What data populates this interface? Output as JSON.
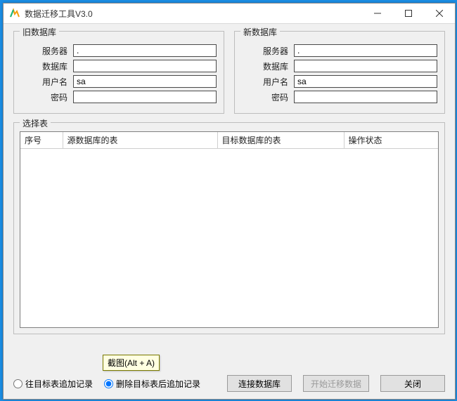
{
  "titlebar": {
    "title": "数据迁移工具V3.0"
  },
  "labels": {
    "server": "服务器",
    "database": "数据库",
    "username": "用户名",
    "password": "密码"
  },
  "old_db": {
    "legend": "旧数据库",
    "server": ".",
    "database": "",
    "username": "sa",
    "password": ""
  },
  "new_db": {
    "legend": "新数据库",
    "server": ".",
    "database": "",
    "username": "sa",
    "password": ""
  },
  "table": {
    "legend": "选择表",
    "columns": [
      "序号",
      "源数据库的表",
      "目标数据库的表",
      "操作状态"
    ],
    "rows": []
  },
  "toolbar": {
    "radio_append": "往目标表追加记录",
    "radio_delete_append": "删除目标表后追加记录",
    "connect": "连接数据库",
    "start": "开始迁移数据",
    "close": "关闭",
    "mode_selected": "delete_append"
  },
  "tooltip": {
    "text": "截图(Alt + A)"
  }
}
